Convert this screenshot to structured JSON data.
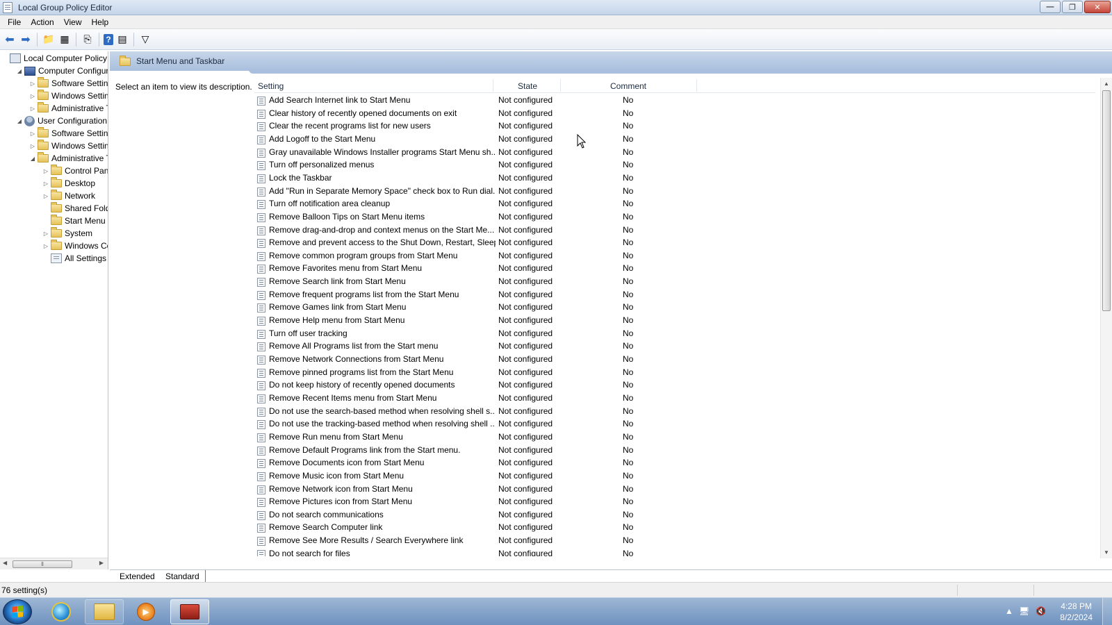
{
  "window": {
    "title": "Local Group Policy Editor",
    "buttons": {
      "minimize": "—",
      "restore": "❐",
      "close": "✕"
    }
  },
  "menubar": [
    "File",
    "Action",
    "View",
    "Help"
  ],
  "toolbar": {
    "icons": [
      "back-arrow-icon",
      "forward-arrow-icon",
      "up-folder-icon",
      "show-hide-tree-icon",
      "export-list-icon",
      "help-icon",
      "show-hide-action-pane-icon",
      "filter-icon"
    ]
  },
  "tree": {
    "items": [
      {
        "label": "Local Computer Policy",
        "level": 0,
        "twisty": "",
        "icon": "policy-icon"
      },
      {
        "label": "Computer Configuration",
        "level": 1,
        "twisty": "◢",
        "icon": "computer-icon"
      },
      {
        "label": "Software Settings",
        "level": 2,
        "twisty": "▷",
        "icon": "folder-icon"
      },
      {
        "label": "Windows Settings",
        "level": 2,
        "twisty": "▷",
        "icon": "folder-icon"
      },
      {
        "label": "Administrative Templates",
        "level": 2,
        "twisty": "▷",
        "icon": "folder-icon"
      },
      {
        "label": "User Configuration",
        "level": 1,
        "twisty": "◢",
        "icon": "user-icon"
      },
      {
        "label": "Software Settings",
        "level": 2,
        "twisty": "▷",
        "icon": "folder-icon"
      },
      {
        "label": "Windows Settings",
        "level": 2,
        "twisty": "▷",
        "icon": "folder-icon"
      },
      {
        "label": "Administrative Templates",
        "level": 2,
        "twisty": "◢",
        "icon": "folder-icon"
      },
      {
        "label": "Control Panel",
        "level": 3,
        "twisty": "▷",
        "icon": "folder-icon"
      },
      {
        "label": "Desktop",
        "level": 3,
        "twisty": "▷",
        "icon": "folder-icon"
      },
      {
        "label": "Network",
        "level": 3,
        "twisty": "▷",
        "icon": "folder-icon"
      },
      {
        "label": "Shared Folders",
        "level": 3,
        "twisty": "",
        "icon": "folder-icon"
      },
      {
        "label": "Start Menu and Taskbar",
        "level": 3,
        "twisty": "",
        "icon": "folder-icon"
      },
      {
        "label": "System",
        "level": 3,
        "twisty": "▷",
        "icon": "folder-icon"
      },
      {
        "label": "Windows Components",
        "level": 3,
        "twisty": "▷",
        "icon": "folder-icon"
      },
      {
        "label": "All Settings",
        "level": 3,
        "twisty": "",
        "icon": "all-settings-icon"
      }
    ]
  },
  "pane": {
    "title": "Start Menu and Taskbar",
    "description": "Select an item to view its description.",
    "columns": {
      "setting": "Setting",
      "state": "State",
      "comment": "Comment"
    }
  },
  "settings": [
    {
      "name": "Add Search Internet link to Start Menu",
      "state": "Not configured",
      "comment": "No"
    },
    {
      "name": "Clear history of recently opened documents on exit",
      "state": "Not configured",
      "comment": "No"
    },
    {
      "name": "Clear the recent programs list for new users",
      "state": "Not configured",
      "comment": "No"
    },
    {
      "name": "Add Logoff to the Start Menu",
      "state": "Not configured",
      "comment": "No"
    },
    {
      "name": "Gray unavailable Windows Installer programs Start Menu sh...",
      "state": "Not configured",
      "comment": "No"
    },
    {
      "name": "Turn off personalized menus",
      "state": "Not configured",
      "comment": "No"
    },
    {
      "name": "Lock the Taskbar",
      "state": "Not configured",
      "comment": "No"
    },
    {
      "name": "Add \"Run in Separate Memory Space\" check box to Run dial...",
      "state": "Not configured",
      "comment": "No"
    },
    {
      "name": "Turn off notification area cleanup",
      "state": "Not configured",
      "comment": "No"
    },
    {
      "name": "Remove Balloon Tips on Start Menu items",
      "state": "Not configured",
      "comment": "No"
    },
    {
      "name": "Remove drag-and-drop and context menus on the Start Me...",
      "state": "Not configured",
      "comment": "No"
    },
    {
      "name": "Remove and prevent access to the Shut Down, Restart, Sleep...",
      "state": "Not configured",
      "comment": "No"
    },
    {
      "name": "Remove common program groups from Start Menu",
      "state": "Not configured",
      "comment": "No"
    },
    {
      "name": "Remove Favorites menu from Start Menu",
      "state": "Not configured",
      "comment": "No"
    },
    {
      "name": "Remove Search link from Start Menu",
      "state": "Not configured",
      "comment": "No"
    },
    {
      "name": "Remove frequent programs list from the Start Menu",
      "state": "Not configured",
      "comment": "No"
    },
    {
      "name": "Remove Games link from Start Menu",
      "state": "Not configured",
      "comment": "No"
    },
    {
      "name": "Remove Help menu from Start Menu",
      "state": "Not configured",
      "comment": "No"
    },
    {
      "name": "Turn off user tracking",
      "state": "Not configured",
      "comment": "No"
    },
    {
      "name": "Remove All Programs list from the Start menu",
      "state": "Not configured",
      "comment": "No"
    },
    {
      "name": "Remove Network Connections from Start Menu",
      "state": "Not configured",
      "comment": "No"
    },
    {
      "name": "Remove pinned programs list from the Start Menu",
      "state": "Not configured",
      "comment": "No"
    },
    {
      "name": "Do not keep history of recently opened documents",
      "state": "Not configured",
      "comment": "No"
    },
    {
      "name": "Remove Recent Items menu from Start Menu",
      "state": "Not configured",
      "comment": "No"
    },
    {
      "name": "Do not use the search-based method when resolving shell s...",
      "state": "Not configured",
      "comment": "No"
    },
    {
      "name": "Do not use the tracking-based method when resolving shell ...",
      "state": "Not configured",
      "comment": "No"
    },
    {
      "name": "Remove Run menu from Start Menu",
      "state": "Not configured",
      "comment": "No"
    },
    {
      "name": "Remove Default Programs link from the Start menu.",
      "state": "Not configured",
      "comment": "No"
    },
    {
      "name": "Remove Documents icon from Start Menu",
      "state": "Not configured",
      "comment": "No"
    },
    {
      "name": "Remove Music icon from Start Menu",
      "state": "Not configured",
      "comment": "No"
    },
    {
      "name": "Remove Network icon from Start Menu",
      "state": "Not configured",
      "comment": "No"
    },
    {
      "name": "Remove Pictures icon from Start Menu",
      "state": "Not configured",
      "comment": "No"
    },
    {
      "name": "Do not search communications",
      "state": "Not configured",
      "comment": "No"
    },
    {
      "name": "Remove Search Computer link",
      "state": "Not configured",
      "comment": "No"
    },
    {
      "name": "Remove See More Results / Search Everywhere link",
      "state": "Not configured",
      "comment": "No"
    },
    {
      "name": "Do not search for files",
      "state": "Not configured",
      "comment": "No"
    }
  ],
  "tabs": [
    "Extended",
    "Standard"
  ],
  "status": {
    "text": "76 setting(s)"
  },
  "taskbar": {
    "apps": [
      "internet-explorer-icon",
      "windows-explorer-icon",
      "media-player-icon",
      "group-policy-editor-icon"
    ],
    "time": "4:28 PM",
    "date": "8/2/2024",
    "tray_icons": [
      "show-hidden-icons-icon",
      "network-icon",
      "volume-muted-icon"
    ]
  }
}
